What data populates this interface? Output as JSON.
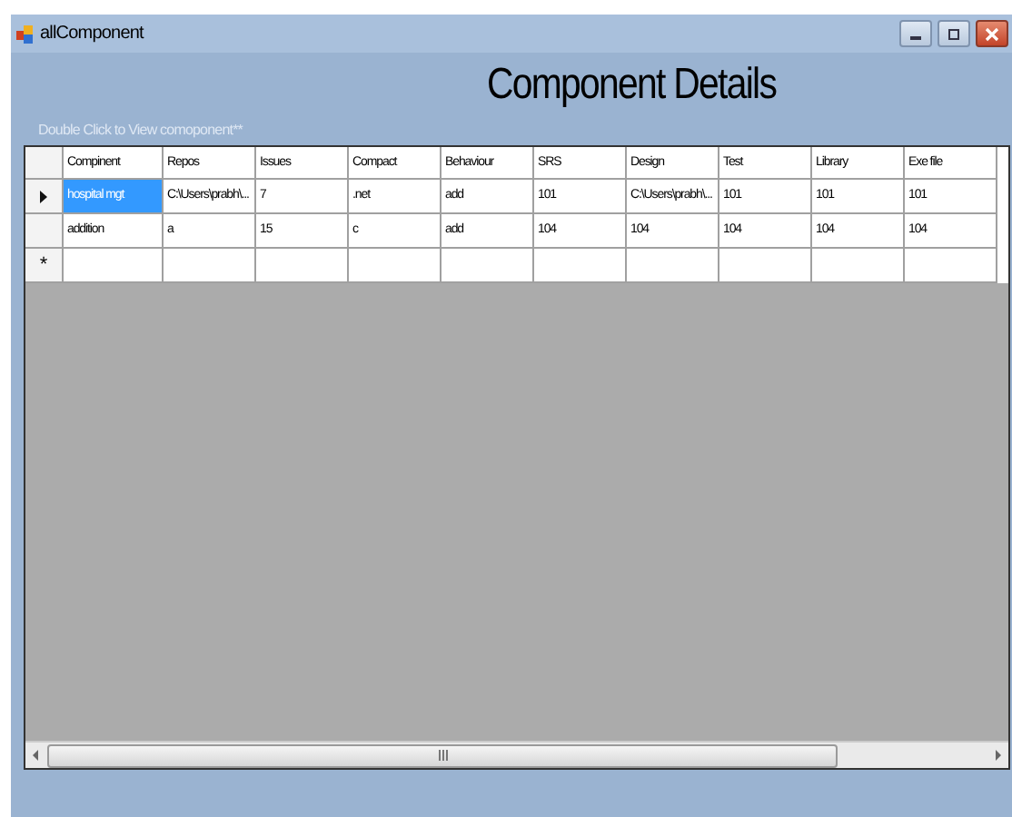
{
  "window": {
    "title": "allComponent"
  },
  "heading": "Component Details",
  "hint": "Double Click to View comoponent**",
  "table": {
    "columns": [
      "Compinent",
      "Repos",
      "Issues",
      "Compact",
      "Behaviour",
      "SRS",
      "Design",
      "Test",
      "Library",
      "Exe file"
    ],
    "rows": [
      {
        "current": true,
        "cells": [
          {
            "text": "hospital mgt",
            "selected": true
          },
          {
            "text": "C:\\Users\\prabh\\...",
            "selected": false
          },
          {
            "text": "7",
            "selected": false
          },
          {
            "text": ".net",
            "selected": false
          },
          {
            "text": "add",
            "selected": false
          },
          {
            "text": "101",
            "selected": false
          },
          {
            "text": "C:\\Users\\prabh\\...",
            "selected": false
          },
          {
            "text": "101",
            "selected": false
          },
          {
            "text": "101",
            "selected": false
          },
          {
            "text": "101",
            "selected": false
          }
        ]
      },
      {
        "current": false,
        "cells": [
          {
            "text": "addition",
            "selected": false
          },
          {
            "text": "a",
            "selected": false
          },
          {
            "text": "15",
            "selected": false
          },
          {
            "text": "c",
            "selected": false
          },
          {
            "text": "add",
            "selected": false
          },
          {
            "text": "104",
            "selected": false
          },
          {
            "text": "104",
            "selected": false
          },
          {
            "text": "104",
            "selected": false
          },
          {
            "text": "104",
            "selected": false
          },
          {
            "text": "104",
            "selected": false
          }
        ]
      }
    ],
    "new_row_marker": "*"
  }
}
